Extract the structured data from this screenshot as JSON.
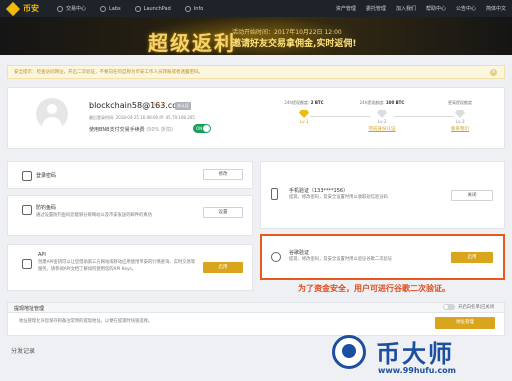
{
  "topbar": {
    "brand": "币安",
    "nav": [
      "交易中心",
      "Labs",
      "LaunchPad",
      "Info"
    ],
    "right": [
      "资产管理",
      "委托管理",
      "加入我们",
      "帮助中心",
      "公告中心",
      "简体中文"
    ]
  },
  "banner": {
    "title": "超级返利",
    "line1": "活动开始时间：2017年10月22日 12:00",
    "line2": "邀请好友交易拿佣金,实时返佣!"
  },
  "notice": "安全提示：检查访问网址，开启二次验证，不要向任何自称为币安工作人员转账或者透露密码。",
  "profile": {
    "email": "blockchain58@163.com",
    "level": "Lv.1",
    "badge": "未认证",
    "login_info": "最后登录时间: 2018-04-25 16:08:00   IP: 45.79.108.205",
    "bnb_label": "使用BNB支付交易手续费",
    "bnb_discount": "(50% 折扣)",
    "bnb_toggle": "ON"
  },
  "levels": [
    {
      "cap": "24h提现额度:",
      "amount": "2 BTC",
      "name": "Lv.1",
      "link": "",
      "color": "#f0b90b"
    },
    {
      "cap": "24h提现额度:",
      "amount": "100 BTC",
      "name": "Lv.2",
      "link": "完成身份认证",
      "color": "#d9dde2"
    },
    {
      "cap": "更高提现额度",
      "amount": "",
      "name": "Lv.3",
      "link": "联系我们",
      "color": "#d9dde2"
    }
  ],
  "rows": {
    "login_pwd": {
      "title": "登录密码",
      "button": "修改"
    },
    "anti_phish": {
      "title": "防钓鱼码",
      "desc": "通过设置防钓鱼码您能够分辨网站以及币安发送的邮件的真伪",
      "button": "设置"
    },
    "api": {
      "title": "API",
      "desc": "创建API密钥可以让您借助第三方网站或移动应用使用币安的行情查询、实时交易等服务。请参阅API文档了解如何使用您的API Keys。",
      "button": "启用"
    },
    "sms": {
      "title": "手机验证（133****156）",
      "desc": "提现、修改密码，及安全设置时用以收取短信验证码",
      "button": "关闭"
    },
    "google": {
      "title": "谷歌验证",
      "desc": "提现、修改密码，及安全设置时用以验证谷歌二次验证",
      "button": "启用"
    }
  },
  "caption": "为了资金安全，用户可进行谷歌二次验证。",
  "withdraw": {
    "title": "提现地址管理",
    "desc": "地址管理允许您保存和备注常用的提现地址，以便在提现时快速选择。",
    "whitelist": "开启白名单|已关闭",
    "button": "地址管理"
  },
  "split_title": "分发记录",
  "watermark": {
    "text": "币大师",
    "url": "www.99hufu.com"
  }
}
